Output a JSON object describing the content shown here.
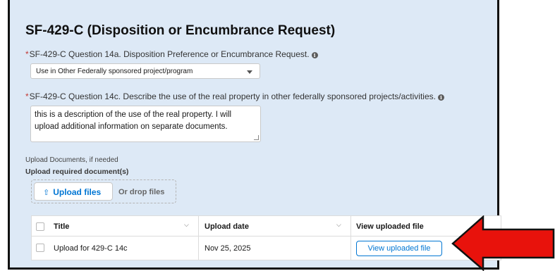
{
  "section": {
    "title": "SF-429-C (Disposition or Encumbrance Request)"
  },
  "question_14a": {
    "required_mark": "*",
    "label": "SF-429-C Question 14a. Disposition Preference or Encumbrance Request.",
    "selected_value": "Use in Other Federally sponsored project/program"
  },
  "question_14c": {
    "required_mark": "*",
    "label": "SF-429-C Question 14c. Describe the use of the real property in other federally sponsored projects/activities.",
    "value_line1": "this is a description of the use of the real property.  I will",
    "value_line2": "upload additional information on separate documents."
  },
  "upload": {
    "helper_text": "Upload Documents, if needed",
    "required_label": "Upload required document(s)",
    "button_label": "Upload files",
    "drop_text": "Or drop files"
  },
  "files_table": {
    "columns": [
      "Title",
      "Upload date",
      "View uploaded file"
    ],
    "rows": [
      {
        "title": "Upload for 429-C 14c",
        "upload_date": "Nov 25, 2025",
        "action_label": "View uploaded file"
      }
    ]
  },
  "colors": {
    "panel_background": "#dde9f6",
    "accent": "#0176d3",
    "required": "#c23934",
    "annotation_arrow": "#e8120c"
  },
  "icons": [
    "info-icon",
    "chevron-down-icon",
    "upload-icon",
    "resize-grip-icon",
    "red-arrow-annotation"
  ]
}
